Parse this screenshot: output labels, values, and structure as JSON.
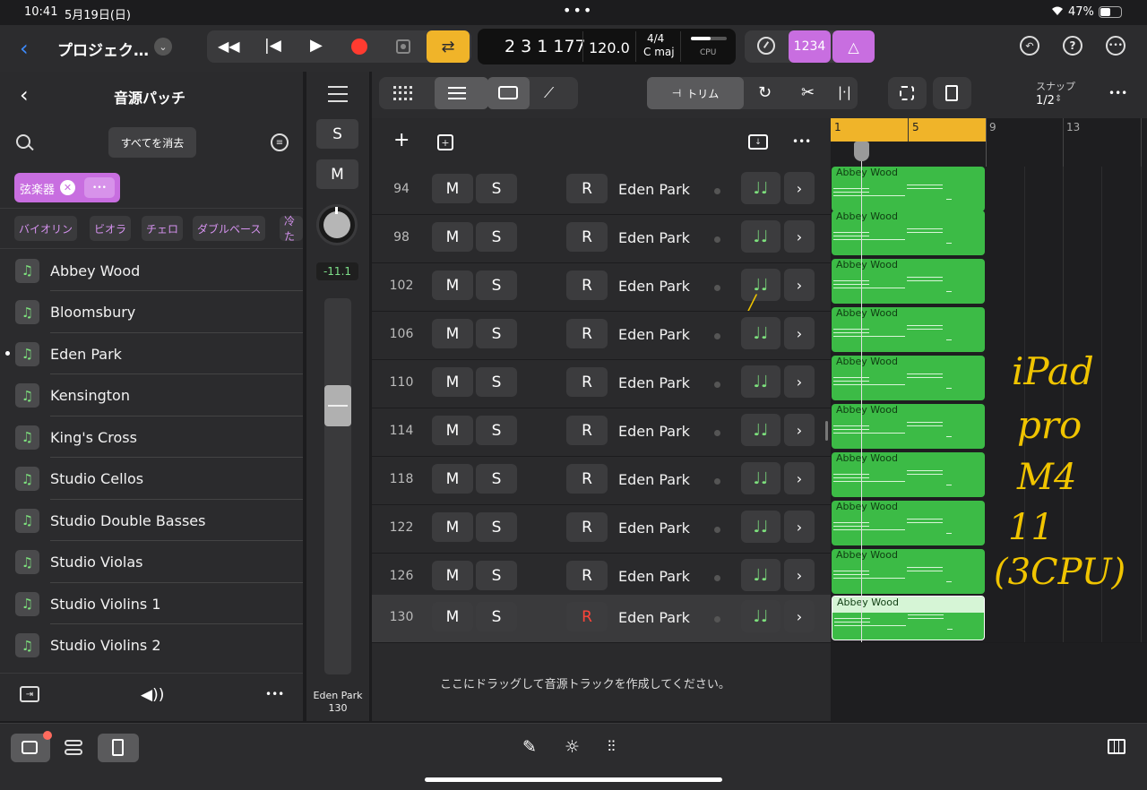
{
  "status": {
    "time": "10:41",
    "date": "5月19日(日)",
    "battery": "47%"
  },
  "toolbar": {
    "project_title": "プロジェク…",
    "position": "2 3 1 177",
    "tempo": "120.0",
    "signature": "4/4",
    "key": "C maj",
    "cpu_label": "CPU",
    "count_in": "1234"
  },
  "library": {
    "title": "音源パッチ",
    "clear_all": "すべてを消去",
    "filter_chip": "弦楽器",
    "chip_more": "•••",
    "categories": [
      "バイオリン",
      "ビオラ",
      "チェロ",
      "ダブルベース",
      "冷た"
    ],
    "patches": [
      "Abbey Wood",
      "Bloomsbury",
      "Eden Park",
      "Kensington",
      "King's Cross",
      "Studio Cellos",
      "Studio Double Basses",
      "Studio Violas",
      "Studio Violins 1",
      "Studio Violins 2"
    ],
    "selected": "Eden Park"
  },
  "channel": {
    "solo": "S",
    "mute": "M",
    "volume": "-11.1",
    "name": "Eden Park",
    "number": "130"
  },
  "tracks_toolbar": {
    "trim_label": "トリム",
    "snap_label": "スナップ",
    "snap_value": "1/2"
  },
  "tracks": [
    {
      "num": "94",
      "name": "Eden Park"
    },
    {
      "num": "98",
      "name": "Eden Park"
    },
    {
      "num": "102",
      "name": "Eden Park"
    },
    {
      "num": "106",
      "name": "Eden Park"
    },
    {
      "num": "110",
      "name": "Eden Park"
    },
    {
      "num": "114",
      "name": "Eden Park"
    },
    {
      "num": "118",
      "name": "Eden Park"
    },
    {
      "num": "122",
      "name": "Eden Park"
    },
    {
      "num": "126",
      "name": "Eden Park"
    },
    {
      "num": "130",
      "name": "Eden Park"
    }
  ],
  "track_buttons": {
    "mute": "M",
    "solo": "S",
    "record": "R"
  },
  "drop_hint": "ここにドラッグして音源トラックを作成してください。",
  "ruler": [
    "1",
    "5",
    "9",
    "13"
  ],
  "region_name": "Abbey Wood",
  "annotation": [
    "iPad",
    "pro",
    "M4",
    "11",
    "(3CPU)"
  ],
  "colors": {
    "accent_yellow": "#f0b429",
    "accent_purple": "#c86ee0",
    "region_green": "#3cbb46",
    "record_red": "#ff3b30"
  }
}
